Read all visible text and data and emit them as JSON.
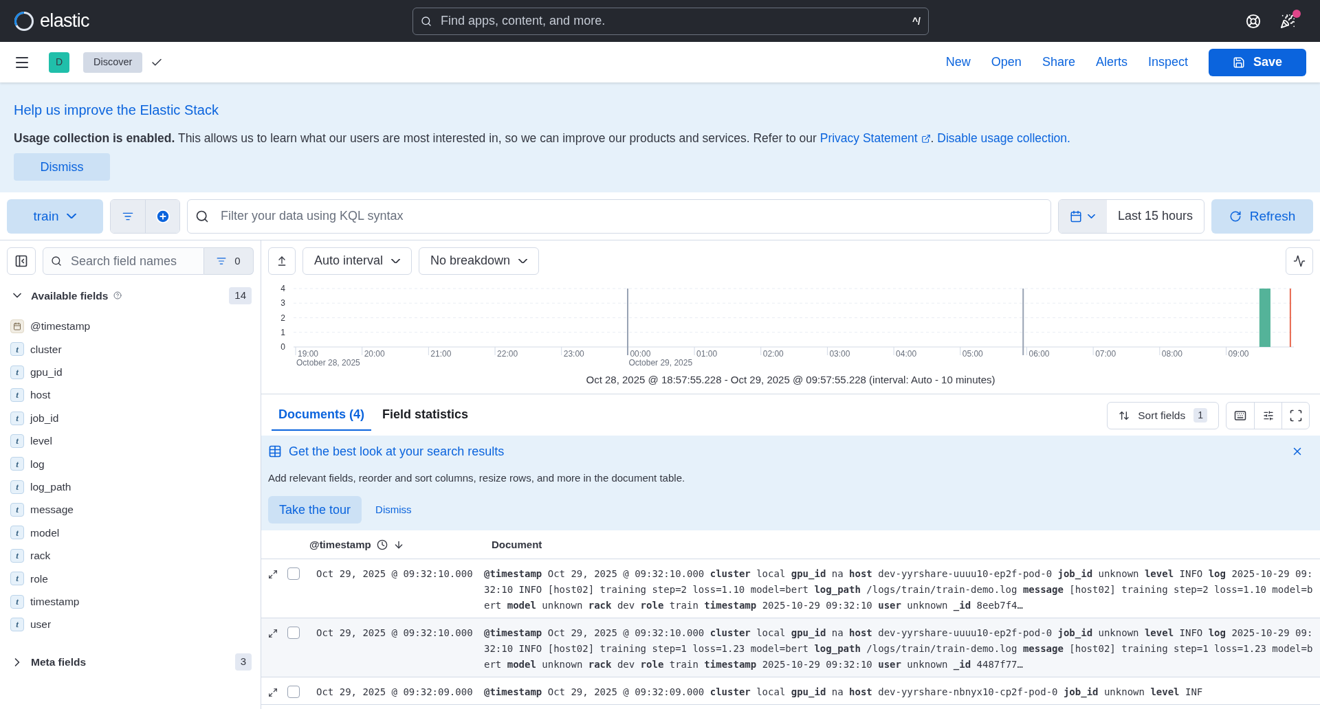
{
  "header": {
    "logo_text": "elastic",
    "search_placeholder": "Find apps, content, and more.",
    "shortcut": "^/",
    "notification": true
  },
  "nav": {
    "avatar": "D",
    "breadcrumb": "Discover",
    "links": [
      "New",
      "Open",
      "Share",
      "Alerts",
      "Inspect"
    ],
    "save": "Save"
  },
  "banner": {
    "title": "Help us improve the Elastic Stack",
    "text": "**Usage collection is enabled.** This allows us to learn what our users are most interested in, so we can improve our products and services. Refer to our",
    "privacy_link": "Privacy Statement",
    "separator": ".",
    "disable_link": "Disable usage collection.",
    "dismiss": "Dismiss"
  },
  "query": {
    "data_view": "train",
    "placeholder": "Filter your data using KQL syntax",
    "time": "Last 15 hours",
    "refresh": "Refresh"
  },
  "sidebar": {
    "search_placeholder": "Search field names",
    "filter_count": "0",
    "available": {
      "title": "Available fields",
      "count": "14",
      "expanded": true,
      "fields": [
        {
          "name": "@timestamp",
          "kind": "date"
        },
        {
          "name": "cluster",
          "kind": "text",
          "token": "t"
        },
        {
          "name": "gpu_id",
          "kind": "text",
          "token": "t"
        },
        {
          "name": "host",
          "kind": "text",
          "token": "t"
        },
        {
          "name": "job_id",
          "kind": "text",
          "token": "t"
        },
        {
          "name": "level",
          "kind": "text",
          "token": "t"
        },
        {
          "name": "log",
          "kind": "text",
          "token": "t"
        },
        {
          "name": "log_path",
          "kind": "text",
          "token": "t"
        },
        {
          "name": "message",
          "kind": "text",
          "token": "t"
        },
        {
          "name": "model",
          "kind": "text",
          "token": "t"
        },
        {
          "name": "rack",
          "kind": "text",
          "token": "t"
        },
        {
          "name": "role",
          "kind": "text",
          "token": "t"
        },
        {
          "name": "timestamp",
          "kind": "text",
          "token": "t"
        },
        {
          "name": "user",
          "kind": "text",
          "token": "t"
        }
      ]
    },
    "meta": {
      "title": "Meta fields",
      "count": "3",
      "expanded": false
    }
  },
  "histogram": {
    "interval": "Auto interval",
    "breakdown": "No breakdown",
    "chart_data": {
      "type": "bar",
      "categories": [
        "19:00",
        "20:00",
        "21:00",
        "22:00",
        "23:00",
        "00:00",
        "01:00",
        "02:00",
        "03:00",
        "04:00",
        "05:00",
        "06:00",
        "07:00",
        "08:00",
        "09:00"
      ],
      "series": [
        {
          "color": "#54b399",
          "values": [
            0,
            0,
            0,
            0,
            0,
            0,
            0,
            0,
            0,
            0,
            0,
            0,
            0,
            0,
            4
          ]
        }
      ],
      "ylim": [
        0,
        4
      ],
      "yticks": [
        0,
        1,
        2,
        3,
        4
      ],
      "grid": true,
      "annotations": [
        "October 28, 2025",
        "October 29, 2025"
      ]
    },
    "caption": "Oct 28, 2025 @ 18:57:55.228 - Oct 29, 2025 @ 09:57:55.228 (interval: Auto - 10 minutes)"
  },
  "tabs": [
    {
      "label": "Documents (4)",
      "selected": true
    },
    {
      "label": "Field statistics",
      "selected": false
    }
  ],
  "sort": {
    "label": "Sort fields",
    "count": "1"
  },
  "callout": {
    "title": "Get the best look at your search results",
    "text": "Add relevant fields, reorder and sort columns, resize rows, and more in the document table.",
    "tour": "Take the tour",
    "dismiss": "Dismiss"
  },
  "table": {
    "columns": [
      "@timestamp",
      "Document"
    ],
    "rows": [
      {
        "timestamp": "Oct 29, 2025 @ 09:32:10.000",
        "checked": false,
        "document": "**@timestamp** Oct 29, 2025 @ 09:32:10.000 **cluster** local **gpu_id** na **host** dev-yyrshare-uuuu10-ep2f-pod-0 **job_id** unknown **level** INFO **log** 2025-10-29 09:32:10 INFO [host02] training step=2 loss=1.10 model=bert **log_path** /logs/train/train-demo.log **message** [host02] training step=2 loss=1.10 model=bert **model** unknown **rack** dev **role** train **timestamp** 2025-10-29 09:32:10 **user** unknown **_id** 8eeb7f4…"
      },
      {
        "timestamp": "Oct 29, 2025 @ 09:32:10.000",
        "checked": false,
        "document": "**@timestamp** Oct 29, 2025 @ 09:32:10.000 **cluster** local **gpu_id** na **host** dev-yyrshare-uuuu10-ep2f-pod-0 **job_id** unknown **level** INFO **log** 2025-10-29 09:32:10 INFO [host02] training step=1 loss=1.23 model=bert **log_path** /logs/train/train-demo.log **message** [host02] training step=1 loss=1.23 model=bert **model** unknown **rack** dev **role** train **timestamp** 2025-10-29 09:32:10 **user** unknown **_id** 4487f77…"
      },
      {
        "timestamp": "Oct 29, 2025 @ 09:32:09.000",
        "checked": false,
        "document": "**@timestamp** Oct 29, 2025 @ 09:32:09.000 **cluster** local **gpu_id** na **host** dev-yyrshare-nbnyx10-cp2f-pod-0 **job_id** unknown **level** INF"
      }
    ]
  }
}
